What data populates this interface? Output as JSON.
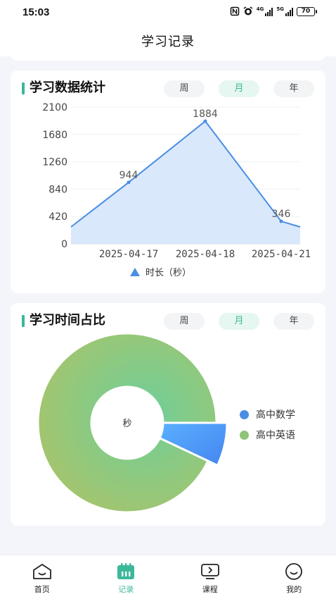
{
  "status_bar": {
    "time": "15:03",
    "signal1_label": "4G",
    "signal2_label": "5G",
    "battery": "70"
  },
  "header": {
    "title": "学习记录"
  },
  "stats_card": {
    "title": "学习数据统计",
    "tabs": [
      {
        "label": "周",
        "active": false
      },
      {
        "label": "月",
        "active": true
      },
      {
        "label": "年",
        "active": false
      }
    ]
  },
  "chart_data": [
    {
      "type": "line",
      "title": "",
      "ylim": [
        0,
        2100
      ],
      "yticks": [
        "0",
        "420",
        "840",
        "1260",
        "1680",
        "2100"
      ],
      "x_tick_labels": [
        "2025-04-17",
        "2025-04-18",
        "2025-04-21"
      ],
      "points": [
        {
          "x": "",
          "y": 260
        },
        {
          "x": "2025-04-17",
          "y": 944,
          "label": "944"
        },
        {
          "x": "2025-04-18",
          "y": 1884,
          "label": "1884"
        },
        {
          "x": "2025-04-21",
          "y": 346,
          "label": "346"
        },
        {
          "x": "",
          "y": 260
        }
      ],
      "series": [
        {
          "name": "时长（秒）"
        }
      ],
      "area_fill": true,
      "legend": "bottom"
    },
    {
      "type": "pie",
      "center_label": "秒",
      "slices": [
        {
          "name": "高中数学",
          "value": 7
        },
        {
          "name": "高中英语",
          "value": 93
        }
      ],
      "legend": "right"
    }
  ],
  "time_card": {
    "title": "学习时间占比",
    "tabs": [
      {
        "label": "周",
        "active": false
      },
      {
        "label": "月",
        "active": true
      },
      {
        "label": "年",
        "active": false
      }
    ]
  },
  "colors": {
    "accent": "#3cb89a",
    "line": "#4a8ee4",
    "area": "#d6e6fb",
    "math": "#4a8ee4",
    "english": "#8fc47a"
  },
  "bottom_nav": [
    {
      "label": "首页",
      "icon": "home-icon",
      "active": false
    },
    {
      "label": "记录",
      "icon": "calendar-icon",
      "active": true
    },
    {
      "label": "课程",
      "icon": "course-icon",
      "active": false
    },
    {
      "label": "我的",
      "icon": "profile-icon",
      "active": false
    }
  ]
}
